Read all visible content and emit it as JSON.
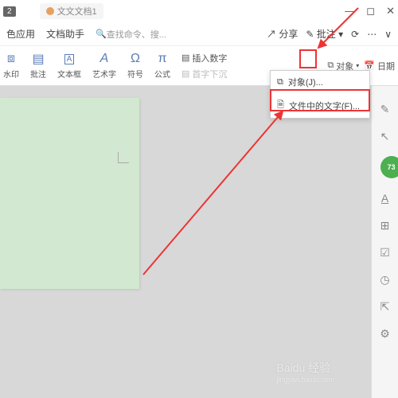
{
  "titlebar": {
    "badge": "2",
    "doc_name": "文文文档1"
  },
  "menubar": {
    "item1": "色应用",
    "item2": "文档助手",
    "search_placeholder": "查找命令、搜...",
    "share": "分享",
    "annotate": "批注"
  },
  "toolbar": {
    "watermark": "水印",
    "comment": "批注",
    "textbox": "文本框",
    "wordart": "艺术字",
    "symbol": "符号",
    "formula": "公式",
    "dropcap": "首字下沉",
    "insert_number": "插入数字",
    "object_btn": "对象",
    "date": "日期"
  },
  "dropdown": {
    "object": "对象(J)...",
    "text_from_file": "文件中的文字(F)..."
  },
  "sidebar": {
    "badge_value": "73"
  },
  "watermark": {
    "main": "Baidu 经验",
    "sub": "jingyan.baidu.com"
  }
}
